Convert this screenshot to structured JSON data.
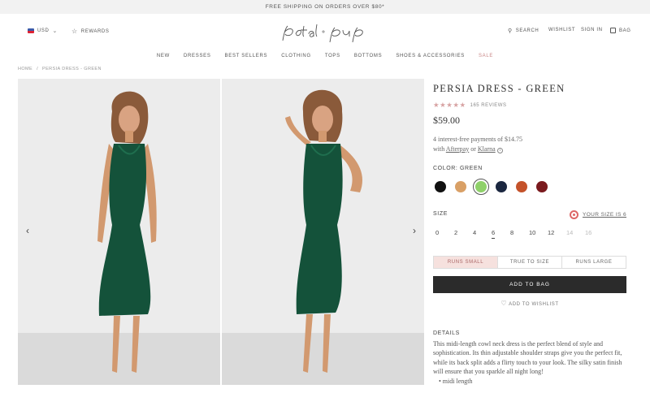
{
  "promo": {
    "text": "FREE SHIPPING ON ORDERS OVER $80*"
  },
  "header": {
    "currency": "USD",
    "rewards": "REWARDS",
    "search": "SEARCH",
    "wishlist": "WISHLIST",
    "signin": "SIGN IN",
    "bag": "BAG",
    "logo_text": "petal + pup"
  },
  "nav": {
    "items": [
      "NEW",
      "DRESSES",
      "BEST SELLERS",
      "CLOTHING",
      "TOPS",
      "BOTTOMS",
      "SHOES & ACCESSORIES",
      "SALE"
    ]
  },
  "breadcrumb": {
    "home": "HOME",
    "separator": "/",
    "current": "PERSIA DRESS - GREEN"
  },
  "product": {
    "title": "PERSIA DRESS - GREEN",
    "stars": "★★★★★",
    "rating": 4.5,
    "reviews": "165 REVIEWS",
    "price": "$59.00",
    "installments_line1": "4 interest-free payments of $14.75",
    "installments_with": "with",
    "afterpay": "Afterpay",
    "or": "or",
    "klarna": "Klarna",
    "info": "i"
  },
  "color": {
    "label": "COLOR: GREEN",
    "swatches": [
      {
        "name": "black",
        "hex": "#111111"
      },
      {
        "name": "tan",
        "hex": "#d9a066"
      },
      {
        "name": "green",
        "hex": "#8fd16a",
        "selected": true
      },
      {
        "name": "navy",
        "hex": "#1b2740"
      },
      {
        "name": "rust",
        "hex": "#c4522a"
      },
      {
        "name": "burgundy",
        "hex": "#7a1a1e"
      }
    ]
  },
  "size": {
    "label": "SIZE",
    "your_size": "YOUR SIZE IS 6",
    "options": [
      {
        "label": "0"
      },
      {
        "label": "2"
      },
      {
        "label": "4"
      },
      {
        "label": "6",
        "selected": true
      },
      {
        "label": "8"
      },
      {
        "label": "10"
      },
      {
        "label": "12"
      },
      {
        "label": "14",
        "disabled": true
      },
      {
        "label": "16",
        "disabled": true
      }
    ]
  },
  "fit": {
    "small": "RUNS SMALL",
    "true": "TRUE TO SIZE",
    "large": "RUNS LARGE"
  },
  "actions": {
    "add_to_bag": "ADD TO BAG",
    "add_to_wishlist": "ADD TO WISHLIST"
  },
  "details": {
    "label": "DETAILS",
    "text": "This midi-length cowl neck dress is the perfect blend of style and sophistication. Its thin adjustable shoulder straps give you the perfect fit, while its back split adds a flirty touch to your look. The silky satin finish will ensure that you sparkle all night long!",
    "bullet": "• midi length"
  },
  "colors": {
    "accent_pink": "#d7a2a2",
    "dress_green": "#14523a",
    "button_dark": "#2b2b2b"
  }
}
